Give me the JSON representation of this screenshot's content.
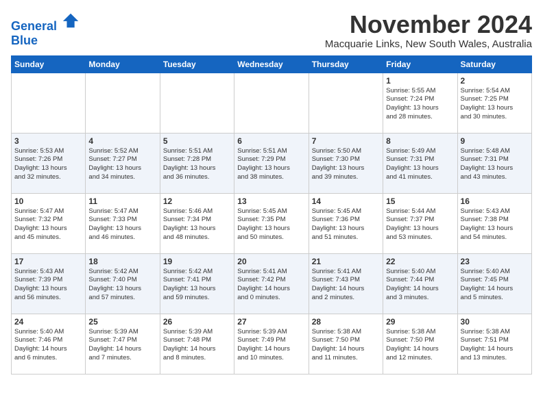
{
  "logo": {
    "line1": "General",
    "line2": "Blue"
  },
  "title": "November 2024",
  "subtitle": "Macquarie Links, New South Wales, Australia",
  "weekdays": [
    "Sunday",
    "Monday",
    "Tuesday",
    "Wednesday",
    "Thursday",
    "Friday",
    "Saturday"
  ],
  "weeks": [
    [
      {
        "day": "",
        "info": ""
      },
      {
        "day": "",
        "info": ""
      },
      {
        "day": "",
        "info": ""
      },
      {
        "day": "",
        "info": ""
      },
      {
        "day": "",
        "info": ""
      },
      {
        "day": "1",
        "info": "Sunrise: 5:55 AM\nSunset: 7:24 PM\nDaylight: 13 hours\nand 28 minutes."
      },
      {
        "day": "2",
        "info": "Sunrise: 5:54 AM\nSunset: 7:25 PM\nDaylight: 13 hours\nand 30 minutes."
      }
    ],
    [
      {
        "day": "3",
        "info": "Sunrise: 5:53 AM\nSunset: 7:26 PM\nDaylight: 13 hours\nand 32 minutes."
      },
      {
        "day": "4",
        "info": "Sunrise: 5:52 AM\nSunset: 7:27 PM\nDaylight: 13 hours\nand 34 minutes."
      },
      {
        "day": "5",
        "info": "Sunrise: 5:51 AM\nSunset: 7:28 PM\nDaylight: 13 hours\nand 36 minutes."
      },
      {
        "day": "6",
        "info": "Sunrise: 5:51 AM\nSunset: 7:29 PM\nDaylight: 13 hours\nand 38 minutes."
      },
      {
        "day": "7",
        "info": "Sunrise: 5:50 AM\nSunset: 7:30 PM\nDaylight: 13 hours\nand 39 minutes."
      },
      {
        "day": "8",
        "info": "Sunrise: 5:49 AM\nSunset: 7:31 PM\nDaylight: 13 hours\nand 41 minutes."
      },
      {
        "day": "9",
        "info": "Sunrise: 5:48 AM\nSunset: 7:31 PM\nDaylight: 13 hours\nand 43 minutes."
      }
    ],
    [
      {
        "day": "10",
        "info": "Sunrise: 5:47 AM\nSunset: 7:32 PM\nDaylight: 13 hours\nand 45 minutes."
      },
      {
        "day": "11",
        "info": "Sunrise: 5:47 AM\nSunset: 7:33 PM\nDaylight: 13 hours\nand 46 minutes."
      },
      {
        "day": "12",
        "info": "Sunrise: 5:46 AM\nSunset: 7:34 PM\nDaylight: 13 hours\nand 48 minutes."
      },
      {
        "day": "13",
        "info": "Sunrise: 5:45 AM\nSunset: 7:35 PM\nDaylight: 13 hours\nand 50 minutes."
      },
      {
        "day": "14",
        "info": "Sunrise: 5:45 AM\nSunset: 7:36 PM\nDaylight: 13 hours\nand 51 minutes."
      },
      {
        "day": "15",
        "info": "Sunrise: 5:44 AM\nSunset: 7:37 PM\nDaylight: 13 hours\nand 53 minutes."
      },
      {
        "day": "16",
        "info": "Sunrise: 5:43 AM\nSunset: 7:38 PM\nDaylight: 13 hours\nand 54 minutes."
      }
    ],
    [
      {
        "day": "17",
        "info": "Sunrise: 5:43 AM\nSunset: 7:39 PM\nDaylight: 13 hours\nand 56 minutes."
      },
      {
        "day": "18",
        "info": "Sunrise: 5:42 AM\nSunset: 7:40 PM\nDaylight: 13 hours\nand 57 minutes."
      },
      {
        "day": "19",
        "info": "Sunrise: 5:42 AM\nSunset: 7:41 PM\nDaylight: 13 hours\nand 59 minutes."
      },
      {
        "day": "20",
        "info": "Sunrise: 5:41 AM\nSunset: 7:42 PM\nDaylight: 14 hours\nand 0 minutes."
      },
      {
        "day": "21",
        "info": "Sunrise: 5:41 AM\nSunset: 7:43 PM\nDaylight: 14 hours\nand 2 minutes."
      },
      {
        "day": "22",
        "info": "Sunrise: 5:40 AM\nSunset: 7:44 PM\nDaylight: 14 hours\nand 3 minutes."
      },
      {
        "day": "23",
        "info": "Sunrise: 5:40 AM\nSunset: 7:45 PM\nDaylight: 14 hours\nand 5 minutes."
      }
    ],
    [
      {
        "day": "24",
        "info": "Sunrise: 5:40 AM\nSunset: 7:46 PM\nDaylight: 14 hours\nand 6 minutes."
      },
      {
        "day": "25",
        "info": "Sunrise: 5:39 AM\nSunset: 7:47 PM\nDaylight: 14 hours\nand 7 minutes."
      },
      {
        "day": "26",
        "info": "Sunrise: 5:39 AM\nSunset: 7:48 PM\nDaylight: 14 hours\nand 8 minutes."
      },
      {
        "day": "27",
        "info": "Sunrise: 5:39 AM\nSunset: 7:49 PM\nDaylight: 14 hours\nand 10 minutes."
      },
      {
        "day": "28",
        "info": "Sunrise: 5:38 AM\nSunset: 7:50 PM\nDaylight: 14 hours\nand 11 minutes."
      },
      {
        "day": "29",
        "info": "Sunrise: 5:38 AM\nSunset: 7:50 PM\nDaylight: 14 hours\nand 12 minutes."
      },
      {
        "day": "30",
        "info": "Sunrise: 5:38 AM\nSunset: 7:51 PM\nDaylight: 14 hours\nand 13 minutes."
      }
    ]
  ]
}
